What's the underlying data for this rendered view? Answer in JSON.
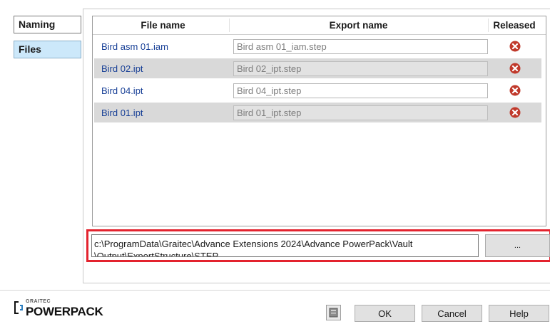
{
  "nav": {
    "items": [
      {
        "label": "Naming"
      },
      {
        "label": "Files"
      }
    ]
  },
  "grid": {
    "columns": {
      "file_name": "File name",
      "export_name": "Export name",
      "released": "Released"
    },
    "rows": [
      {
        "file_name": "Bird asm 01.iam",
        "export_name": "Bird asm 01_iam.step",
        "released_icon": "x-circle-icon"
      },
      {
        "file_name": "Bird 02.ipt",
        "export_name": "Bird 02_ipt.step",
        "released_icon": "x-circle-icon"
      },
      {
        "file_name": "Bird 04.ipt",
        "export_name": "Bird 04_ipt.step",
        "released_icon": "x-circle-icon"
      },
      {
        "file_name": "Bird 01.ipt",
        "export_name": "Bird 01_ipt.step",
        "released_icon": "x-circle-icon"
      }
    ]
  },
  "output": {
    "path_line1": "c:\\ProgramData\\Graitec\\Advance Extensions 2024\\Advance PowerPack\\Vault",
    "path_line2": "\\Output\\ExportStructure\\STEP",
    "browse_label": "..."
  },
  "footer": {
    "logo_small": "GRAITEC",
    "logo_big": "POWERPACK",
    "ok_label": "OK",
    "cancel_label": "Cancel",
    "help_label": "Help"
  },
  "colors": {
    "selected_nav": "#cce8fa",
    "file_link": "#173f96",
    "released_no": "#c0392b",
    "highlight": "#e3232e"
  }
}
